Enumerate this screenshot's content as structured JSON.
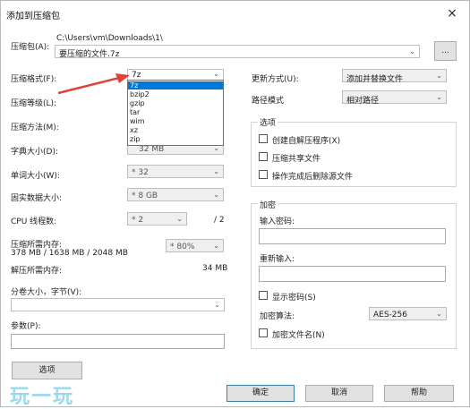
{
  "window": {
    "title": "添加到压缩包",
    "close": "×"
  },
  "archive": {
    "label": "压缩包(A):",
    "path": "C:\\Users\\vm\\Downloads\\1\\",
    "filename": "要压缩的文件.7z",
    "browse": "..."
  },
  "format": {
    "label": "压缩格式(F):",
    "value": "7z",
    "options": [
      "7z",
      "bzip2",
      "gzip",
      "tar",
      "wim",
      "xz",
      "zip"
    ],
    "selected": "7z"
  },
  "level": {
    "label": "压缩等级(L):"
  },
  "method": {
    "label": "压缩方法(M):"
  },
  "dict": {
    "label": "字典大小(D):",
    "value": "32 MB"
  },
  "word": {
    "label": "单词大小(W):",
    "value": "* 32"
  },
  "solid": {
    "label": "固实数据大小:",
    "value": "* 8 GB"
  },
  "cpu": {
    "label": "CPU 线程数:",
    "value": "* 2",
    "total": "/ 2"
  },
  "memory": {
    "compress_label": "压缩所需内存:",
    "compress_value": "378 MB / 1638 MB / 2048 MB",
    "percent": "* 80%",
    "decompress_label": "解压所需内存:",
    "decompress_value": "34 MB"
  },
  "split": {
    "label": "分卷大小，字节(V):"
  },
  "params": {
    "label": "参数(P):"
  },
  "options_btn": "选项",
  "update": {
    "label": "更新方式(U):",
    "value": "添加并替换文件"
  },
  "pathmode": {
    "label": "路径模式",
    "value": "相对路径"
  },
  "opts_group": {
    "title": "选项",
    "items": [
      "创建自解压程序(X)",
      "压缩共享文件",
      "操作完成后删除源文件"
    ]
  },
  "encrypt": {
    "title": "加密",
    "pwd_label": "输入密码:",
    "repeat_label": "重新输入:",
    "show_pwd": "显示密码(S)",
    "method_label": "加密算法:",
    "method_value": "AES-256",
    "encrypt_names": "加密文件名(N)"
  },
  "buttons": {
    "ok": "确定",
    "cancel": "取消",
    "help": "帮助"
  },
  "watermark": "玩一玩",
  "colors": {
    "selection": "#0078d7",
    "arrow": "#e0403a",
    "watermark": "#7fd0e8"
  }
}
